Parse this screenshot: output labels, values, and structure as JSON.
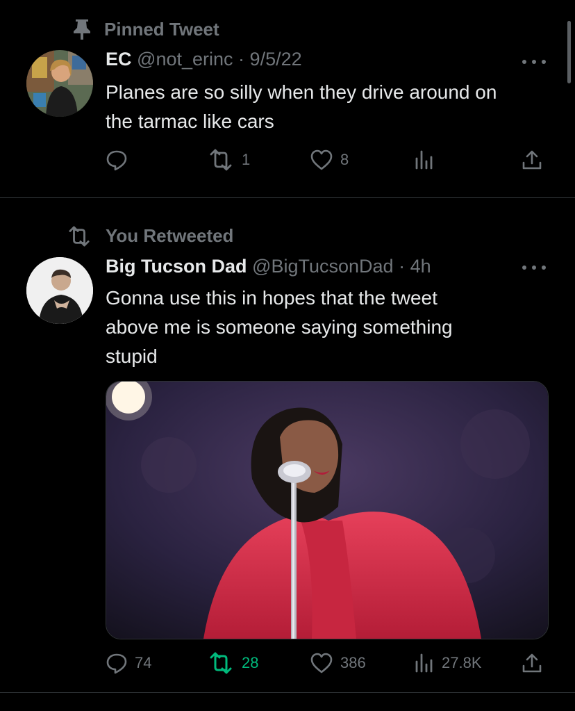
{
  "pinned_tweet": {
    "context_label": "Pinned Tweet",
    "author_name": "EC",
    "author_handle": "@not_erinc",
    "date": "9/5/22",
    "text_line1": "Planes are so silly when they drive around on",
    "text_line2": "the tarmac like cars",
    "replies": "",
    "retweets": "1",
    "likes": "8"
  },
  "retweeted_tweet": {
    "context_label": "You Retweeted",
    "author_name": "Big Tucson Dad",
    "author_handle": "@BigTucsonDad",
    "time": "4h",
    "text_line1": "Gonna use this in hopes that the tweet",
    "text_line2": "above me is someone saying something",
    "text_line3": "stupid",
    "replies": "74",
    "retweets": "28",
    "likes": "386",
    "views": "27.8K"
  },
  "colors": {
    "background": "#000000",
    "text": "#e7e9ea",
    "muted": "#71767b",
    "retweet_active": "#00ba7c",
    "divider": "#2f3336"
  },
  "icons": [
    "pin-icon",
    "retweet-icon",
    "reply-icon",
    "like-icon",
    "views-icon",
    "share-icon",
    "more-icon"
  ]
}
